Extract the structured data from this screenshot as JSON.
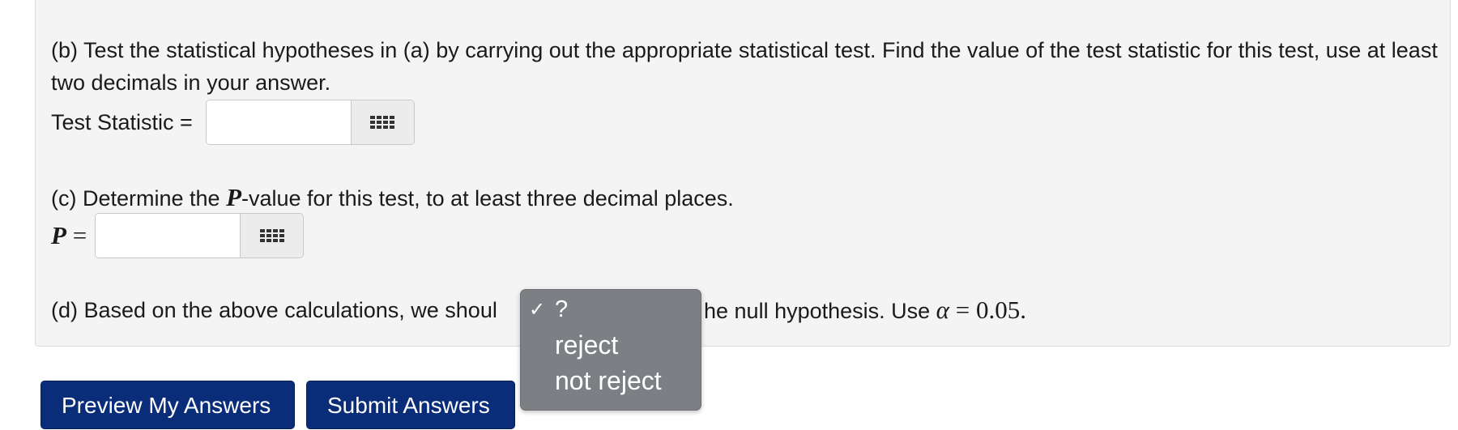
{
  "part_b": {
    "text": "(b) Test the statistical hypotheses in (a) by carrying out the appropriate statistical test. Find the value of the test statistic for this test, use at least two decimals in your answer.",
    "label": "Test Statistic =",
    "input_value": ""
  },
  "part_c": {
    "text_before": "(c) Determine the ",
    "math_symbol": "P",
    "text_after": "-value for this test, to at least three decimal places.",
    "label_symbol": "P",
    "label_equals": " =",
    "input_value": ""
  },
  "part_d": {
    "text_before": "(d) Based on the above calculations, we shoul",
    "text_after": "he null hypothesis. Use ",
    "alpha_symbol": "α",
    "alpha_equals": " = ",
    "alpha_value": "0.05."
  },
  "dropdown": {
    "selected_check": "✓",
    "options": [
      "?",
      "reject",
      "not reject"
    ]
  },
  "buttons": {
    "preview": "Preview My Answers",
    "submit": "Submit Answers"
  },
  "colors": {
    "panel_bg": "#f4f4f4",
    "button_bg": "#0a2d7a",
    "dropdown_bg": "#7c8085"
  }
}
